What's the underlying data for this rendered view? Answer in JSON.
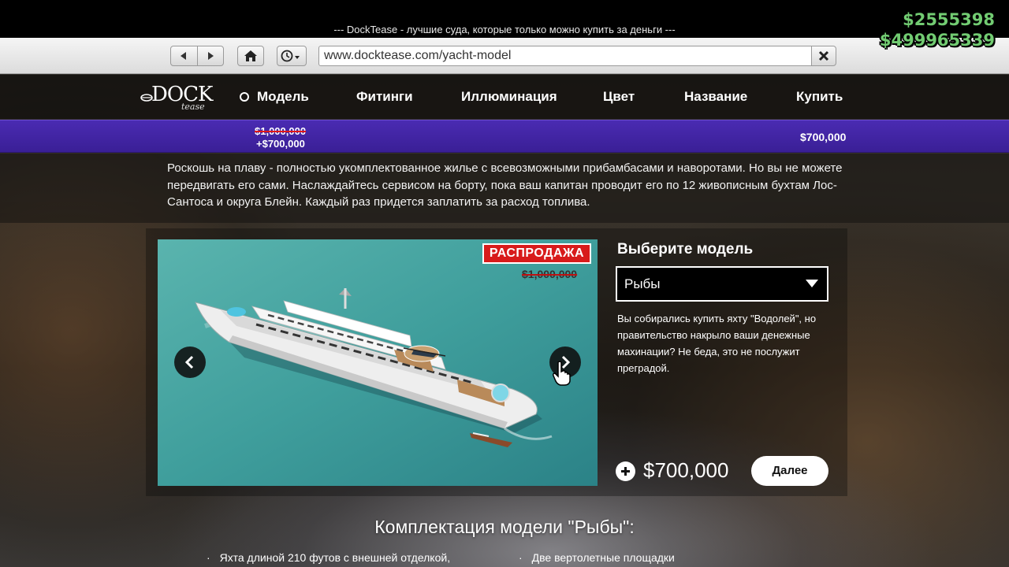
{
  "hud": {
    "cash": "$2555398",
    "bank": "$499965339"
  },
  "browser": {
    "window_title": "--- DockTease - лучшие суда, которые только можно купить за деньги ---",
    "url": "www.docktease.com/yacht-model"
  },
  "site": {
    "logo": "DOCK",
    "logo_sub": "tease",
    "nav": [
      {
        "label": "Модель",
        "active": true
      },
      {
        "label": "Фитинги"
      },
      {
        "label": "Иллюминация"
      },
      {
        "label": "Цвет"
      },
      {
        "label": "Название"
      },
      {
        "label": "Купить"
      }
    ]
  },
  "price_bar": {
    "old_price": "$1,000,000",
    "added_price": "+$700,000",
    "total": "$700,000"
  },
  "description": "Роскошь на плаву - полностью укомплектованное жилье с всевозможными прибамбасами и наворотами. Но вы не можете передвигать его сами. Наслаждайтесь сервисом на борту, пока ваш капитан проводит его по 12 живописным бухтам Лос-Сантоса и округа Блейн. Каждый раз придется заплатить за расход топлива.",
  "gallery": {
    "sale_badge": "РАСПРОДАЖА",
    "old_price": "$1,000,000"
  },
  "model_picker": {
    "label": "Выберите модель",
    "selected": "Рыбы",
    "note": "Вы собирались купить яхту \"Водолей\", но правительство накрыло ваши денежные махинации? Не беда, это не послужит преградой.",
    "price": "$700,000",
    "next_label": "Далее"
  },
  "spec": {
    "title": "Комплектация модели \"Рыбы\":",
    "items": [
      "Яхта длиной 210 футов с внешней отделкой,",
      "Две вертолетные площадки"
    ]
  },
  "colors": {
    "accent_purple": "#3f23a0",
    "sale_red": "#d81b1b",
    "hud_green": "#72cc72"
  }
}
